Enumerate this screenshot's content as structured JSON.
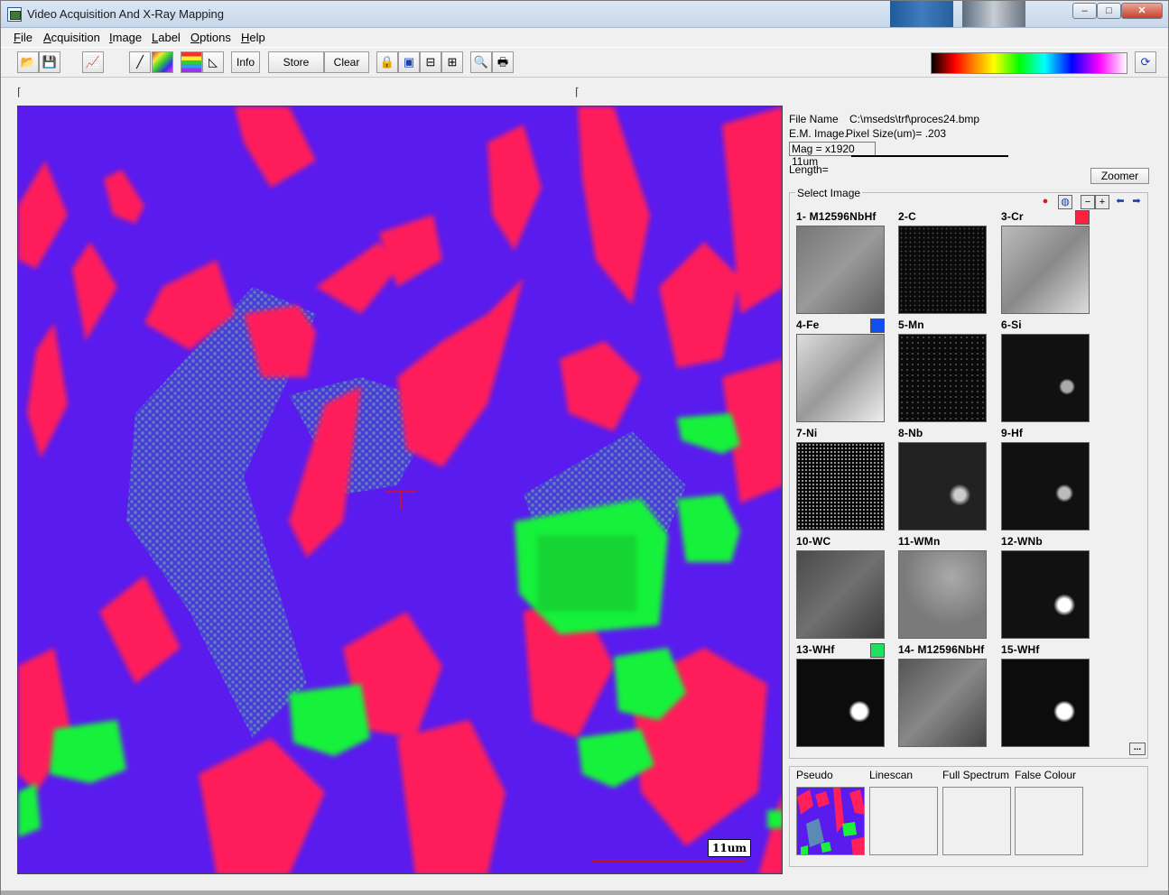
{
  "window": {
    "title": "Video Acquisition And X-Ray Mapping",
    "min": "–",
    "max": "□",
    "close": "✕"
  },
  "menu": [
    "File",
    "Acquisition",
    "Image",
    "Label",
    "Options",
    "Help"
  ],
  "toolbar": {
    "info": "Info",
    "store": "Store",
    "clear": "Clear"
  },
  "info": {
    "file_name_label": "File Name",
    "file_name_value": "C:\\mseds\\trf\\proces24.bmp",
    "em_image": "E.M. Image.",
    "pixel_size": "Pixel Size(um)= .203",
    "mag": "Mag = x1920  11um",
    "length": "Length=",
    "zoomer": "Zoomer"
  },
  "select_image": {
    "label": "Select Image",
    "thumbnails": [
      {
        "label": "1- M12596NbHf",
        "swatch": ""
      },
      {
        "label": "2-C",
        "swatch": ""
      },
      {
        "label": "3-Cr",
        "swatch": "#ff2040"
      },
      {
        "label": "4-Fe",
        "swatch": "#1050f0"
      },
      {
        "label": "5-Mn",
        "swatch": ""
      },
      {
        "label": "6-Si",
        "swatch": ""
      },
      {
        "label": "7-Ni",
        "swatch": ""
      },
      {
        "label": "8-Nb",
        "swatch": ""
      },
      {
        "label": "9-Hf",
        "swatch": ""
      },
      {
        "label": "10-WC",
        "swatch": ""
      },
      {
        "label": "11-WMn",
        "swatch": ""
      },
      {
        "label": "12-WNb",
        "swatch": ""
      },
      {
        "label": "13-WHf",
        "swatch": "#20e060"
      },
      {
        "label": "14- M12596NbHf",
        "swatch": ""
      },
      {
        "label": "15-WHf",
        "swatch": ""
      }
    ],
    "more": "..."
  },
  "bottom_panel": {
    "pseudo": "Pseudo",
    "linescan": "Linescan",
    "full_spectrum": "Full Spectrum",
    "false_colour": "False Colour"
  },
  "scale_bar": "11um",
  "colors": {
    "bg_blue": "#5a1bef",
    "phase_red": "#ff1f5a",
    "phase_green": "#19f23a",
    "phase_teal": "#4f7fb8"
  }
}
